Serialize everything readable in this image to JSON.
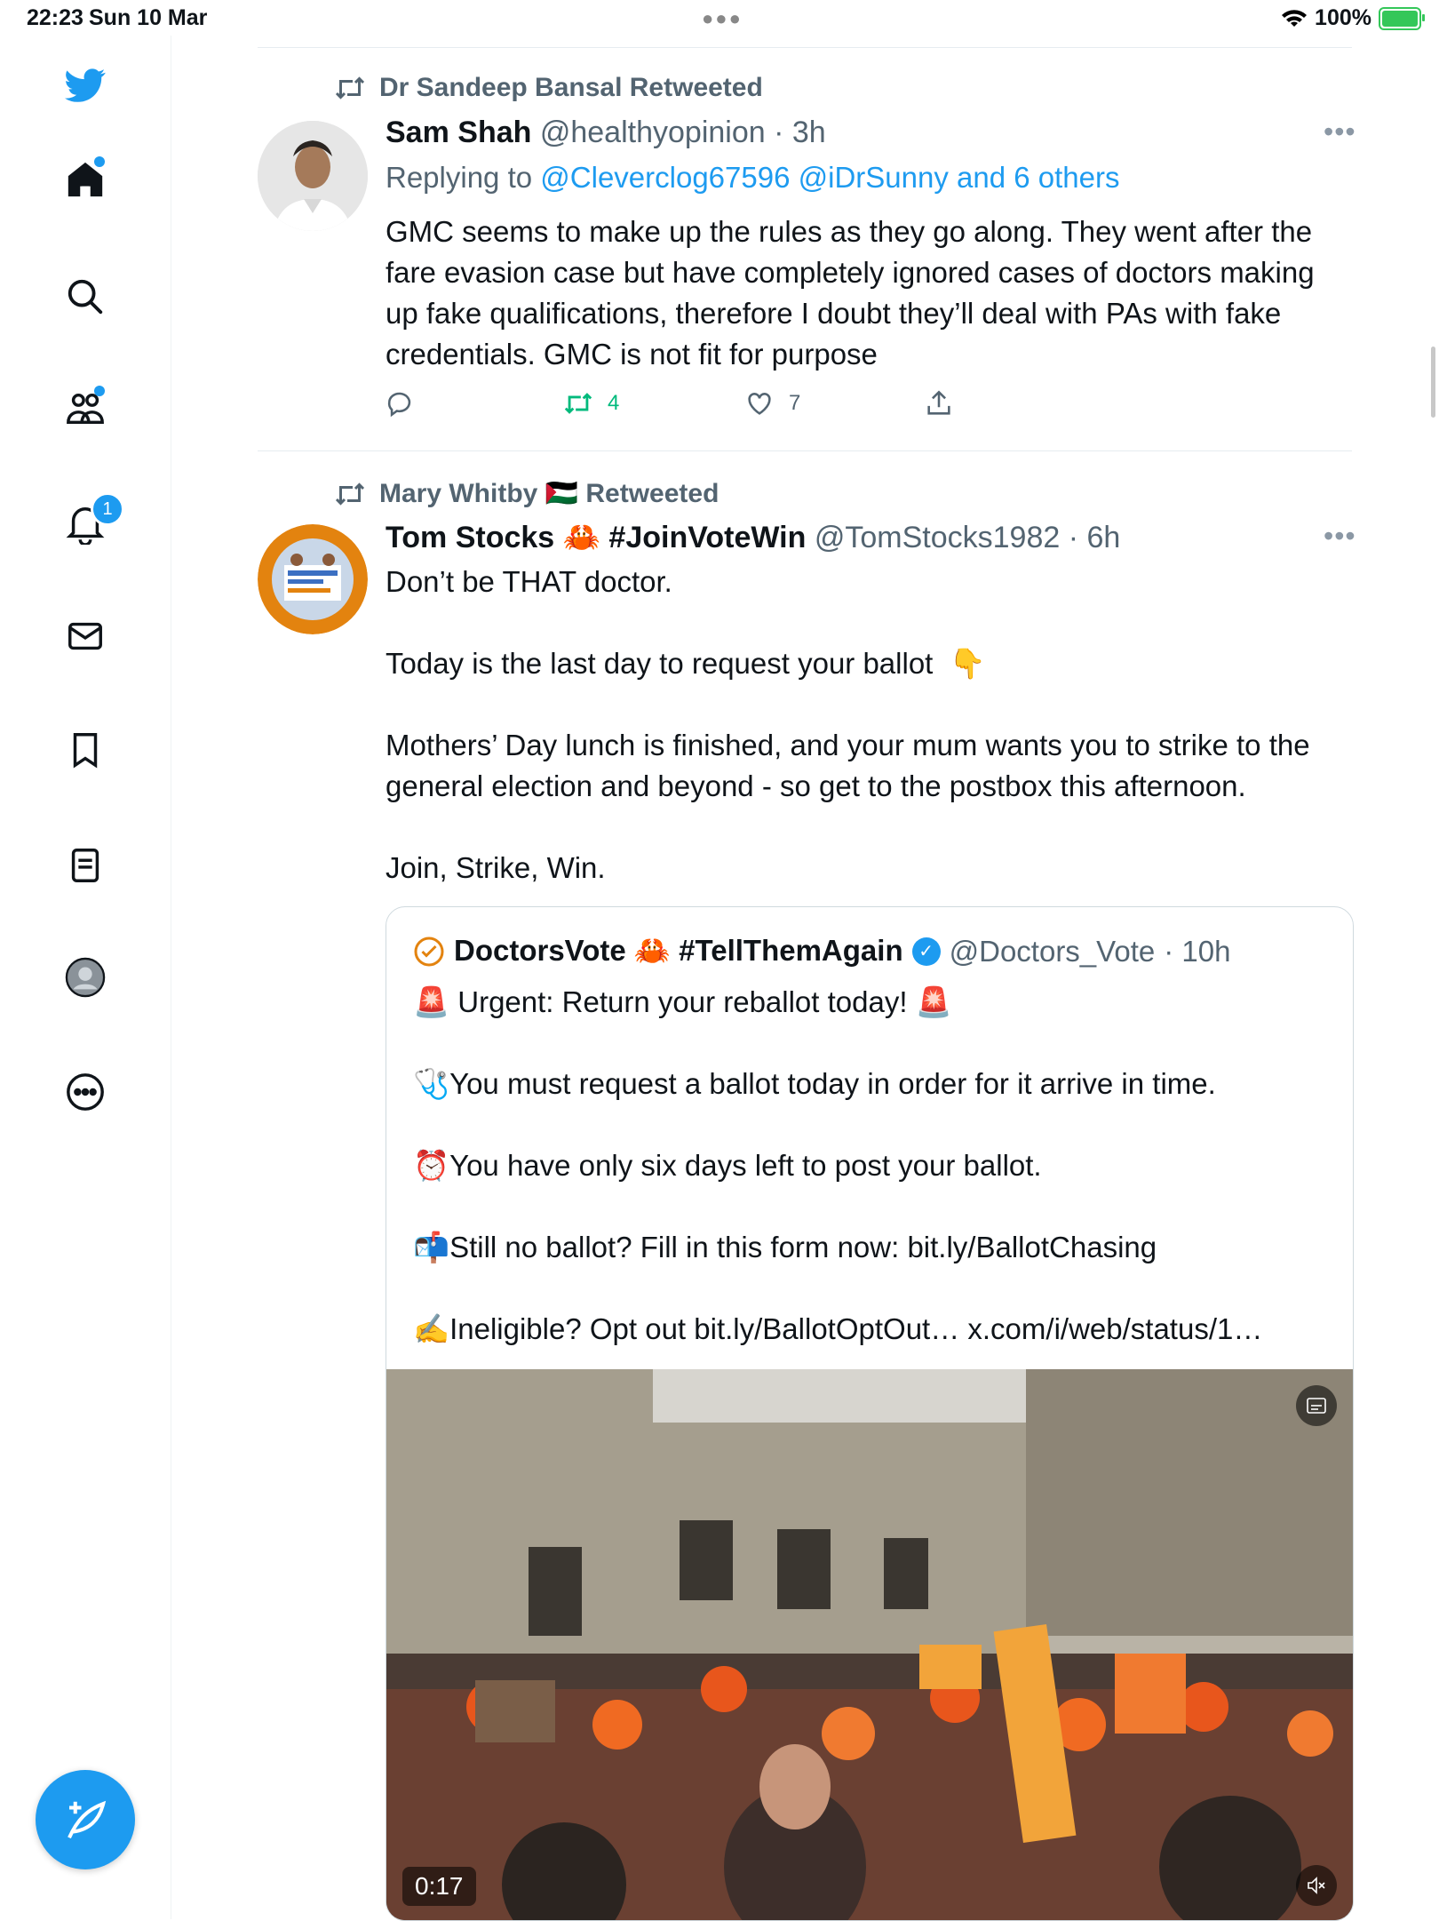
{
  "status_bar": {
    "time": "22:23",
    "date": "Sun 10 Mar",
    "battery": "100%"
  },
  "sidebar": {
    "notification_count": "1",
    "items": [
      "home-icon",
      "search-icon",
      "communities-icon",
      "notifications-icon",
      "messages-icon",
      "bookmarks-icon",
      "lists-icon",
      "profile-icon",
      "more-icon"
    ]
  },
  "colors": {
    "accent": "#1d9bf0",
    "retweet_green": "#00ba7c",
    "secondary_text": "#536471"
  },
  "tweets": [
    {
      "retweeted_by": "Dr Sandeep Bansal Retweeted",
      "name": "Sam Shah",
      "handle": "@healthyopinion",
      "time": "· 3h",
      "replying_label": "Replying to",
      "replying_to": "@Cleverclog67596 @iDrSunny and 6 others",
      "text": "GMC seems to make up the rules as they go along. They went after the fare evasion case but have completely ignored cases of doctors making up fake qualifications, therefore I doubt they’ll deal with PAs with fake credentials. GMC is not fit for purpose",
      "retweets": "4",
      "likes": "7"
    },
    {
      "retweeted_by": "Mary Whitby 🇵🇸 Retweeted",
      "name": "Tom Stocks 🦀 #JoinVoteWin",
      "handle": "@TomStocks1982",
      "time": "· 6h",
      "text": "Don’t be THAT doctor.\n\nToday is the last day to request your ballot  👇\n\nMothers’ Day lunch is finished, and your mum wants you to strike to the general election and beyond - so get to the postbox this afternoon.\n\nJoin, Strike, Win.",
      "quote": {
        "name": "DoctorsVote 🦀 #TellThemAgain",
        "handle": "@Doctors_Vote",
        "time": "· 10h",
        "text": "🚨 Urgent: Return your reballot today! 🚨\n\n🩺You must request a ballot today in order for it arrive in time.\n\n⏰You have only six days left to post your ballot.\n\n📬Still no ballot? Fill in this form now: bit.ly/BallotChasing\n\n✍️Ineligible? Opt out bit.ly/BallotOptOut… x.com/i/web/status/1…",
        "video_duration": "0:17"
      }
    }
  ]
}
